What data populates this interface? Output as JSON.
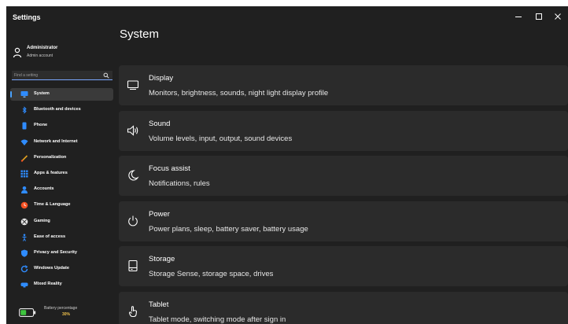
{
  "window": {
    "app_title": "Settings",
    "controls": [
      "minimize",
      "maximize",
      "close"
    ]
  },
  "user": {
    "name": "Administrator",
    "role": "Admin account"
  },
  "search": {
    "placeholder": "Find a setting"
  },
  "sidebar": {
    "items": [
      {
        "label": "System",
        "icon": "monitor-icon",
        "active": true
      },
      {
        "label": "Bluetooth and devices",
        "icon": "bluetooth-icon"
      },
      {
        "label": "Phone",
        "icon": "phone-icon"
      },
      {
        "label": "Network and Internet",
        "icon": "network-icon"
      },
      {
        "label": "Personalization",
        "icon": "paintbrush-icon"
      },
      {
        "label": "Apps & features",
        "icon": "apps-grid-icon"
      },
      {
        "label": "Accounts",
        "icon": "accounts-icon"
      },
      {
        "label": "Time & Language",
        "icon": "clock-icon"
      },
      {
        "label": "Gaming",
        "icon": "gaming-icon"
      },
      {
        "label": "Ease of access",
        "icon": "accessibility-icon"
      },
      {
        "label": "Privacy and Security",
        "icon": "shield-icon"
      },
      {
        "label": "Windows Update",
        "icon": "update-icon"
      },
      {
        "label": "Mixed Reality",
        "icon": "headset-icon"
      }
    ]
  },
  "battery": {
    "title": "Battery percentage",
    "value": "30%"
  },
  "main": {
    "title": "System",
    "cards": [
      {
        "title": "Display",
        "description": "Monitors, brightness, sounds, night light display profile",
        "icon": "display-icon"
      },
      {
        "title": "Sound",
        "description": "Volume levels, input, output, sound devices",
        "icon": "speaker-icon"
      },
      {
        "title": "Focus assist",
        "description": "Notifications, rules",
        "icon": "moon-icon"
      },
      {
        "title": "Power",
        "description": "Power plans, sleep, battery saver, battery usage",
        "icon": "power-icon"
      },
      {
        "title": "Storage",
        "description": "Storage Sense, storage space, drives",
        "icon": "storage-icon"
      },
      {
        "title": "Tablet",
        "description": "Tablet mode, switching mode after sign in",
        "icon": "tablet-touch-icon"
      }
    ]
  },
  "colors": {
    "background": "#202020",
    "card": "#2b2b2b",
    "selected": "#3a3a3a",
    "accent": "#4aa3ff",
    "battery": "#f0c14b"
  }
}
